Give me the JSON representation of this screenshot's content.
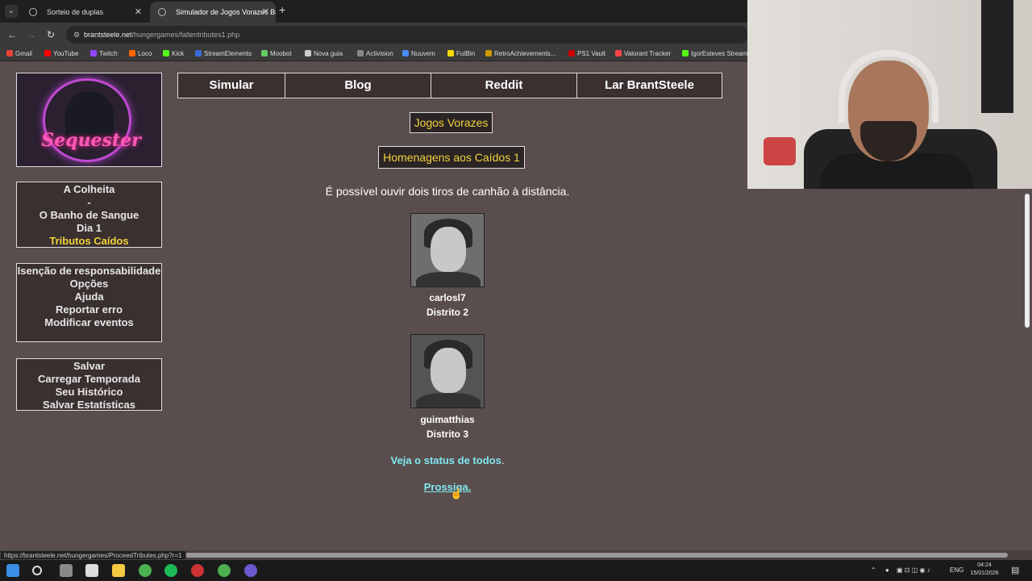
{
  "browser": {
    "tabs": [
      {
        "label": "Sorteio de duplas"
      },
      {
        "label": "Simulador de Jogos Vorazes Br"
      }
    ],
    "url_host": "brantsteele.net",
    "url_path": "/hungergames/fallentributes1.php",
    "bookmarks": [
      "Gmail",
      "YouTube",
      "Twitch",
      "Loco",
      "Kick",
      "StreamElements",
      "Moobot",
      "Nova guia",
      "Activision",
      "Nuuvem",
      "FutBin",
      "RetroAchievements...",
      "PS1 Vault",
      "Valorant Tracker",
      "IgorEsteves Stream"
    ]
  },
  "logo": {
    "text": "Sequester"
  },
  "side_menu_1": [
    "A Colheita",
    "-",
    "O Banho de Sangue",
    "Dia 1",
    "Tributos Caídos"
  ],
  "side_menu_2": [
    "Isenção de responsabilidade",
    "Opções",
    "Ajuda",
    "Reportar erro",
    "Modificar eventos"
  ],
  "side_menu_3": [
    "Salvar",
    "Carregar Temporada",
    "Seu Histórico",
    "Salvar Estatísticas"
  ],
  "top_nav": [
    "Simular",
    "Blog",
    "Reddit",
    "Lar BrantSteele"
  ],
  "game_title": "Jogos Vorazes",
  "section_title": "Homenagens aos Caídos 1",
  "message": "É possível ouvir dois tiros de canhão à distância.",
  "tributes": [
    {
      "name": "carlosl7",
      "district": "Distrito 2"
    },
    {
      "name": "guimatthias",
      "district": "Distrito 3"
    }
  ],
  "status_link": "Veja o status de todos",
  "status_dot": ".",
  "proceed_link": "Prossiga.",
  "status_bar_url": "https://brantsteele.net/hungergames/ProceedTributes.php?r=1",
  "taskbar": {
    "lang": "ENG",
    "time": "04:24",
    "date": "15/01/2026"
  }
}
